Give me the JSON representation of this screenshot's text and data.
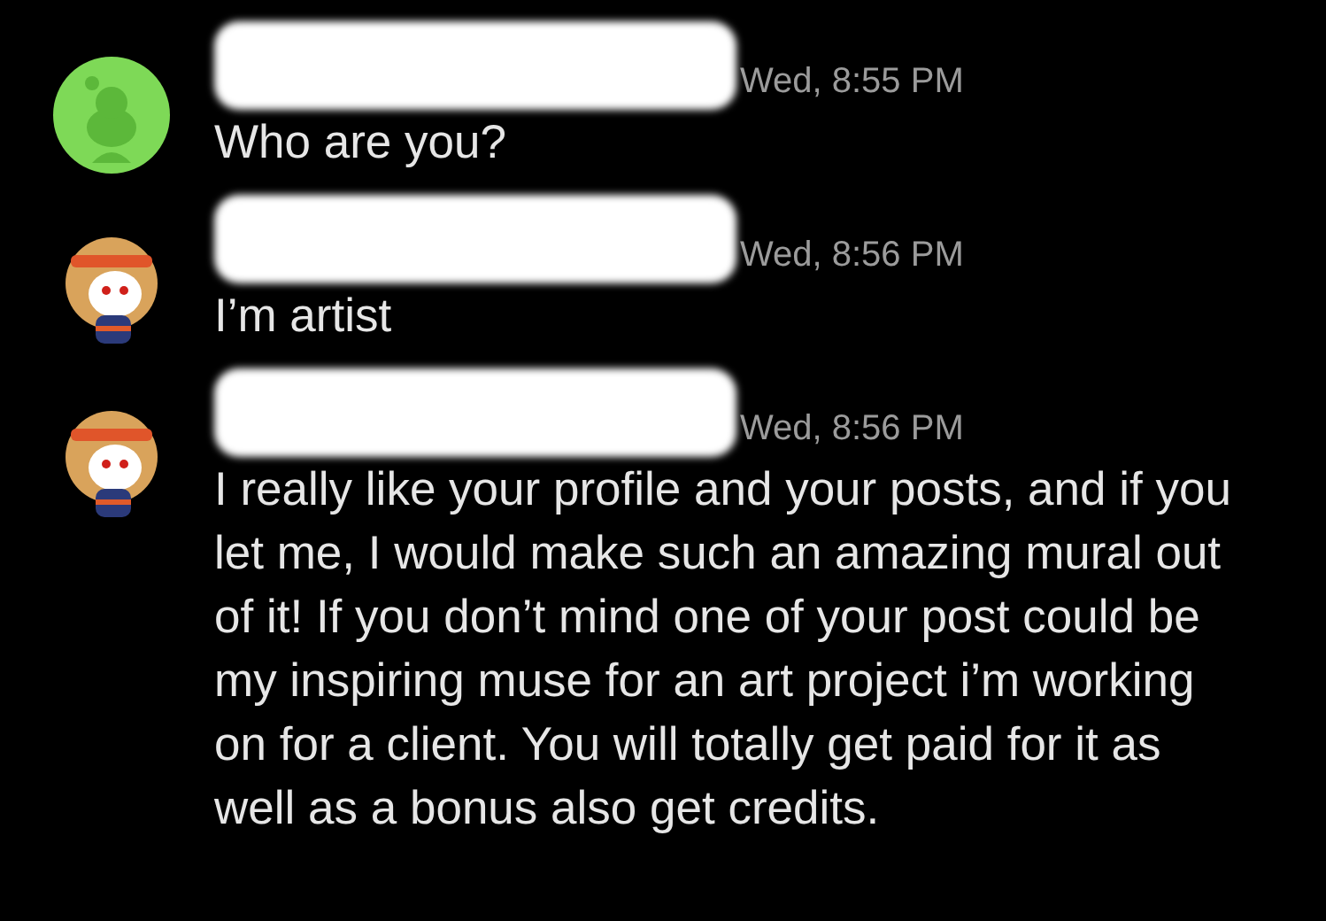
{
  "messages": [
    {
      "kind": "green",
      "time": "Wed, 8:55 PM",
      "text": "Who are you?"
    },
    {
      "kind": "character",
      "time": "Wed, 8:56 PM",
      "text": "I’m artist"
    },
    {
      "kind": "character",
      "time": "Wed, 8:56 PM",
      "text": "I really like your profile and your posts, and if you let me, I would make such an amazing mural out of it! If you don’t mind one of your post could be my inspiring muse for an art project i’m working on for a client. You will totally get paid for it as well as a bonus also get credits."
    }
  ]
}
